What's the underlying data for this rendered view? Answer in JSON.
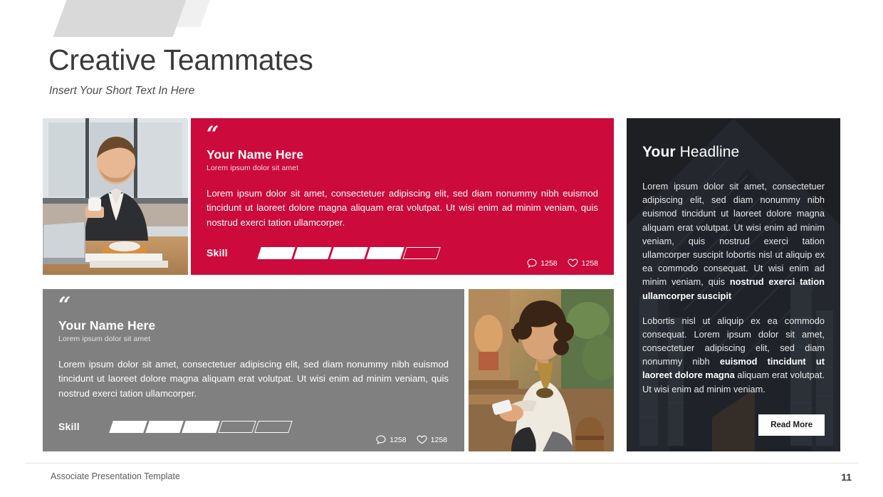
{
  "slide": {
    "title": "Creative Teammates",
    "subtitle": "Insert Your Short Text In Here"
  },
  "footer": {
    "text": "Associate Presentation Template",
    "page_number": "11"
  },
  "colors": {
    "accent_red": "#CC0A3C",
    "card_gray": "#808080",
    "card_dark": "#1D1F22",
    "title_text": "#3A3A3A"
  },
  "cards": {
    "red": {
      "quote_mark": "“",
      "name": "Your Name Here",
      "role": "Lorem  ipsum dolor sit amet",
      "body": "Lorem ipsum dolor sit amet, consectetuer adipiscing elit, sed diam nonummy nibh euismod tincidunt ut laoreet dolore magna aliquam erat volutpat. Ut wisi enim ad minim veniam, quis nostrud exerci tation ullamcorper.",
      "skill_label": "Skill",
      "skill_filled": 4,
      "skill_total": 5,
      "comments": "1258",
      "likes": "1258"
    },
    "gray": {
      "quote_mark": "“",
      "name": "Your Name Here",
      "role": "Lorem  ipsum dolor sit amet",
      "body": "Lorem ipsum dolor sit amet, consectetuer adipiscing elit, sed diam nonummy nibh euismod tincidunt ut laoreet dolore magna aliquam erat volutpat. Ut wisi enim ad minim veniam, quis nostrud exerci tation ullamcorper.",
      "skill_label": "Skill",
      "skill_filled": 3,
      "skill_total": 5,
      "comments": "1258",
      "likes": "1258"
    },
    "dark": {
      "headline_bold": "Your",
      "headline_rest": " Headline",
      "paragraph_1_plain": "Lorem ipsum dolor sit amet, consectetuer adipiscing elit, sed diam nonummy nibh euismod tincidunt ut laoreet dolore magna aliquam erat volutpat. Ut wisi enim ad minim veniam, quis nostrud exerci tation ullamcorper suscipit lobortis nisl ut aliquip ex ea commodo consequat. Ut wisi enim ad minim veniam, quis ",
      "paragraph_1_bold": "nostrud exerci tation ullamcorper suscipit",
      "paragraph_2_a": "Lobortis nisl ut aliquip ex ea commodo consequat. Lorem ipsum dolor sit amet, consectetuer adipiscing elit, sed diam nonummy nibh ",
      "paragraph_2_bold": "euismod tincidunt ut laoreet dolore magna",
      "paragraph_2_b": " aliquam erat volutpat. Ut wisi enim ad minim veniam.",
      "read_more_label": "Read More"
    }
  },
  "photos": {
    "man": "businessman-with-coffee-at-laptop",
    "woman": "woman-with-phone-at-cafe"
  }
}
